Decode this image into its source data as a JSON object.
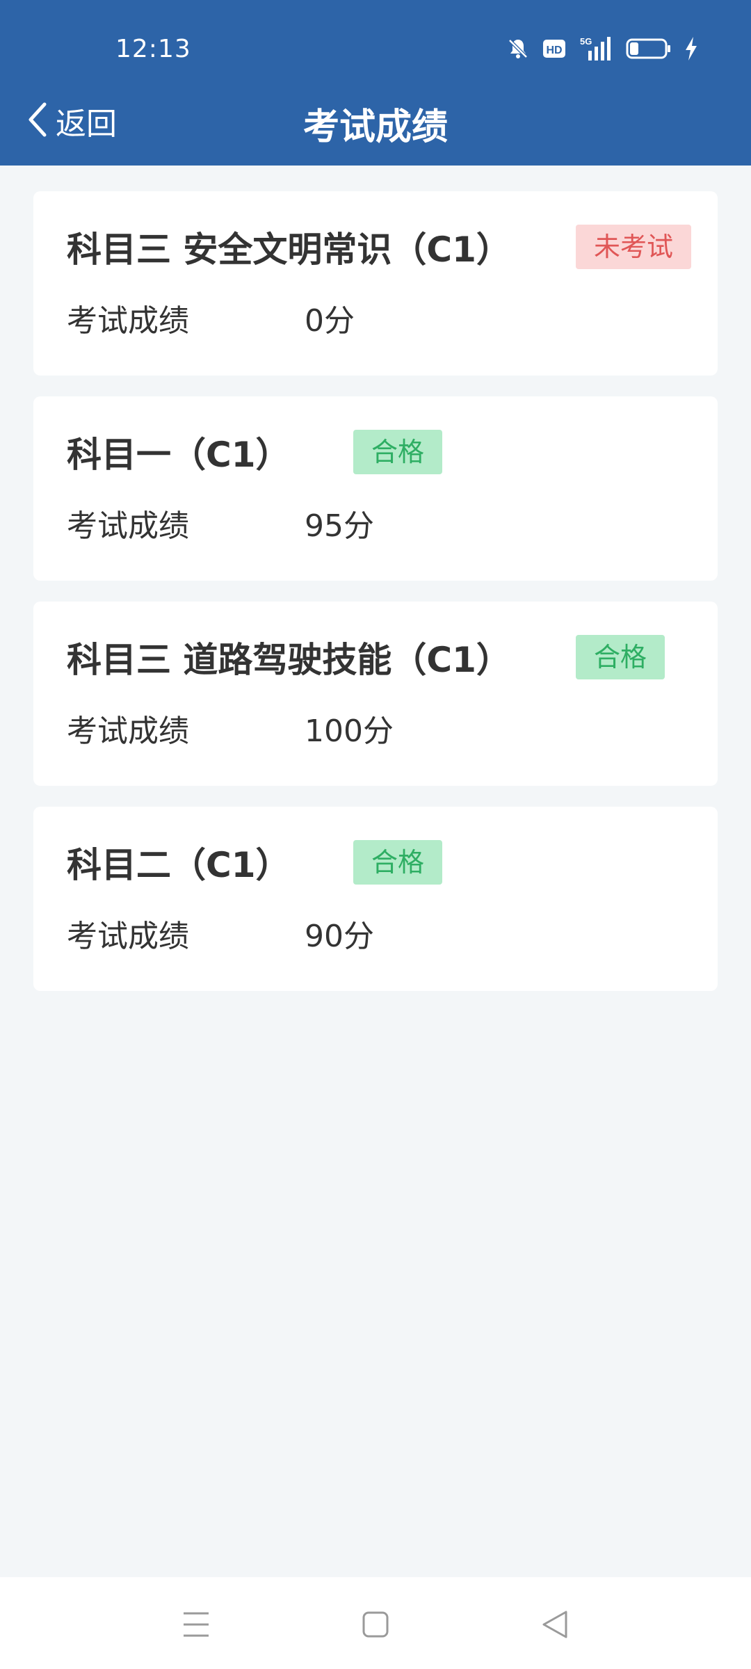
{
  "status_bar": {
    "time": "12:13",
    "icons": [
      "bell-muted-icon",
      "hd-icon",
      "signal-5g-icon",
      "battery-icon",
      "charging-icon"
    ]
  },
  "header": {
    "back_label": "返回",
    "title": "考试成绩"
  },
  "exams": [
    {
      "title": "科目三 安全文明常识（C1）",
      "status": "未考试",
      "status_type": "fail",
      "score_label": "考试成绩",
      "score": "0分"
    },
    {
      "title": "科目一（C1）",
      "status": "合格",
      "status_type": "pass",
      "score_label": "考试成绩",
      "score": "95分"
    },
    {
      "title": "科目三 道路驾驶技能（C1）",
      "status": "合格",
      "status_type": "pass",
      "score_label": "考试成绩",
      "score": "100分"
    },
    {
      "title": "科目二（C1）",
      "status": "合格",
      "status_type": "pass",
      "score_label": "考试成绩",
      "score": "90分"
    }
  ],
  "colors": {
    "header_bg": "#2d64a8",
    "page_bg": "#f3f6f8",
    "pass_bg": "#b3ebc9",
    "pass_text": "#2eae63",
    "fail_bg": "#fbd7d7",
    "fail_text": "#e05656"
  },
  "system_nav": [
    "menu-icon",
    "home-icon",
    "back-triangle-icon"
  ]
}
